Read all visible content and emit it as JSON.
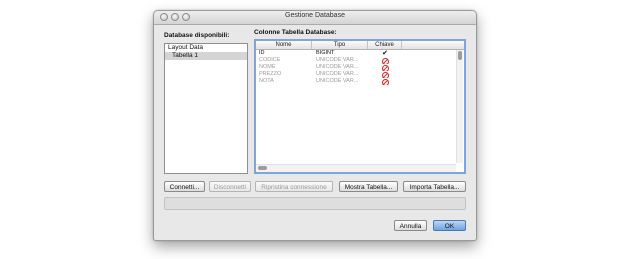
{
  "window": {
    "title": "Gestione Database"
  },
  "left": {
    "label": "Database disponibili:",
    "items": [
      {
        "label": "Layout Data",
        "selected": false
      },
      {
        "label": "Tabella 1",
        "selected": true
      }
    ]
  },
  "right": {
    "label": "Colonne Tabella Database:",
    "columns": [
      "Nome",
      "Tipo",
      "Chiave"
    ],
    "rows": [
      {
        "nome": "ID",
        "tipo": "BIGINT",
        "chiave": "check",
        "enabled": true
      },
      {
        "nome": "CODICE",
        "tipo": "UNICODE VAR...",
        "chiave": "forbidden",
        "enabled": false
      },
      {
        "nome": "NOME",
        "tipo": "UNICODE VAR...",
        "chiave": "forbidden",
        "enabled": false
      },
      {
        "nome": "PREZZO",
        "tipo": "UNICODE VAR...",
        "chiave": "forbidden",
        "enabled": false
      },
      {
        "nome": "NOTA",
        "tipo": "UNICODE VAR...",
        "chiave": "forbidden",
        "enabled": false
      }
    ]
  },
  "buttons": {
    "connetti": "Connetti...",
    "disconnetti": "Disconnetti",
    "ripristina": "Ripristina connessione",
    "mostra": "Mostra Tabella...",
    "importa": "Importa Tabella...",
    "annulla": "Annulla",
    "ok": "OK"
  }
}
